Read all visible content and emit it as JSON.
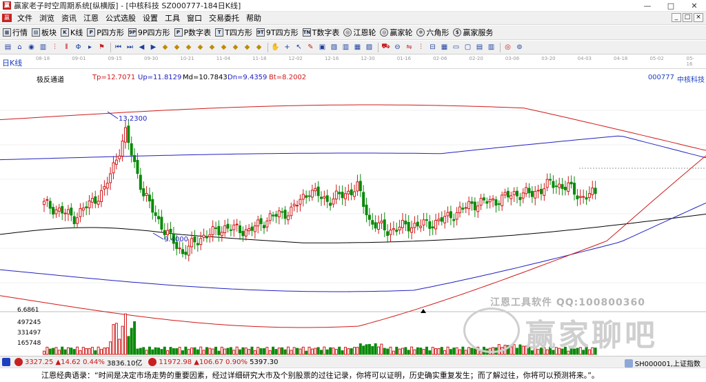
{
  "window": {
    "title": "赢家老子时空周期系统[纵横版] - [中核科技  SZ000777-184日K线]",
    "minimize": "—",
    "maximize": "□",
    "close": "✕"
  },
  "menu": {
    "items": [
      "文件",
      "浏览",
      "资讯",
      "江恩",
      "公式选股",
      "设置",
      "工具",
      "窗口",
      "交易委托",
      "帮助"
    ],
    "mdi_buttons": [
      "_",
      "□",
      "×"
    ]
  },
  "toolbar1": {
    "items": [
      {
        "label": "行情",
        "icon": "grid-icon",
        "glyph": "▦"
      },
      {
        "label": "板块",
        "icon": "blocks-icon",
        "glyph": "▤"
      },
      {
        "label": "K线",
        "icon": "kline-icon",
        "glyph": "K"
      },
      {
        "label": "P四方形",
        "icon": "p-square-icon",
        "glyph": "P"
      },
      {
        "label": "9P四方形",
        "icon": "9p-square-icon",
        "glyph": "9P"
      },
      {
        "label": "P数字表",
        "icon": "p-number-icon",
        "glyph": "P"
      },
      {
        "label": "T四方形",
        "icon": "t-square-icon",
        "glyph": "T"
      },
      {
        "label": "9T四方形",
        "icon": "9t-square-icon",
        "glyph": "9T"
      },
      {
        "label": "T数字表",
        "icon": "t-number-icon",
        "glyph": "TN"
      },
      {
        "label": "江恩轮",
        "icon": "gann-wheel-icon",
        "glyph": "◎",
        "round": true
      },
      {
        "label": "赢家轮",
        "icon": "winner-wheel-icon",
        "glyph": "◎",
        "round": true
      },
      {
        "label": "六角形",
        "icon": "hexagon-icon",
        "glyph": "✲",
        "round": true
      },
      {
        "label": "赢家服务",
        "icon": "service-icon",
        "glyph": "$",
        "round": true
      }
    ]
  },
  "toolbar2": {
    "tools": [
      {
        "name": "layout-icon",
        "glyph": "▤",
        "tone": "b"
      },
      {
        "name": "bell-icon",
        "glyph": "⌂",
        "tone": "b"
      },
      {
        "name": "cycle-icon",
        "glyph": "◉",
        "tone": "b"
      },
      {
        "name": "list-icon",
        "glyph": "▥",
        "tone": "b"
      },
      {
        "name": "candle-icon",
        "glyph": "⫶",
        "tone": "r"
      },
      {
        "name": "bars-icon",
        "glyph": "⫴",
        "tone": "r"
      },
      {
        "name": "line-type-icon",
        "glyph": "Φ",
        "tone": "b"
      },
      {
        "name": "arrow-icon",
        "glyph": "▸",
        "tone": "b"
      },
      {
        "name": "flag-icon",
        "glyph": "⚑",
        "tone": "r"
      },
      {
        "name": "first-icon",
        "glyph": "⏮",
        "tone": "b"
      },
      {
        "name": "next-icon",
        "glyph": "⏭",
        "tone": "b"
      },
      {
        "name": "left-icon",
        "glyph": "◀",
        "tone": "b"
      },
      {
        "name": "right-icon",
        "glyph": "▶",
        "tone": "b"
      },
      {
        "name": "diamond1-icon",
        "glyph": "◆",
        "tone": "y"
      },
      {
        "name": "diamond2-icon",
        "glyph": "◆",
        "tone": "y"
      },
      {
        "name": "diamond3-icon",
        "glyph": "◆",
        "tone": "y"
      },
      {
        "name": "diamond4-icon",
        "glyph": "◆",
        "tone": "y"
      },
      {
        "name": "diamond5-icon",
        "glyph": "◆",
        "tone": "y"
      },
      {
        "name": "diamond6-icon",
        "glyph": "◆",
        "tone": "y"
      },
      {
        "name": "diamond7-icon",
        "glyph": "◆",
        "tone": "y"
      },
      {
        "name": "diamond8-icon",
        "glyph": "◆",
        "tone": "y"
      },
      {
        "name": "diamond9-icon",
        "glyph": "◆",
        "tone": "y"
      },
      {
        "name": "hand-icon",
        "glyph": "✋",
        "tone": "b"
      },
      {
        "name": "crosshair-icon",
        "glyph": "+",
        "tone": "b"
      },
      {
        "name": "cursor-icon",
        "glyph": "↖",
        "tone": "b"
      },
      {
        "name": "pen-icon",
        "glyph": "✎",
        "tone": "r"
      },
      {
        "name": "note-icon",
        "glyph": "▣",
        "tone": "b"
      },
      {
        "name": "image-icon",
        "glyph": "▧",
        "tone": "b"
      },
      {
        "name": "book-icon",
        "glyph": "▥",
        "tone": "b"
      },
      {
        "name": "table-icon",
        "glyph": "▦",
        "tone": "b"
      },
      {
        "name": "chart-icon",
        "glyph": "▨",
        "tone": "b"
      },
      {
        "name": "truck-icon",
        "glyph": "⛟",
        "tone": "r"
      },
      {
        "name": "zoom-out-icon",
        "glyph": "⊖",
        "tone": "b"
      },
      {
        "name": "compare-icon",
        "glyph": "⇋",
        "tone": "r"
      },
      {
        "name": "kline-small-icon",
        "glyph": "⫶",
        "tone": "r"
      },
      {
        "name": "measure-icon",
        "glyph": "⊟",
        "tone": "b"
      },
      {
        "name": "grid2-icon",
        "glyph": "▦",
        "tone": "b"
      },
      {
        "name": "monitor-icon",
        "glyph": "▭",
        "tone": "b"
      },
      {
        "name": "window-icon",
        "glyph": "▢",
        "tone": "b"
      },
      {
        "name": "tile-icon",
        "glyph": "▤",
        "tone": "b"
      },
      {
        "name": "column-icon",
        "glyph": "▥",
        "tone": "b"
      },
      {
        "name": "target-icon",
        "glyph": "◎",
        "tone": "r"
      },
      {
        "name": "globe-icon",
        "glyph": "⊚",
        "tone": "b"
      }
    ]
  },
  "chart_header": {
    "period": "日K线",
    "date_ticks": [
      "08-18",
      "09-01",
      "09-15",
      "09-30",
      "10-21",
      "11-04",
      "11-18",
      "12-02",
      "12-16",
      "12-30",
      "01-16",
      "02-06",
      "02-20",
      "03-06",
      "03-20",
      "04-03",
      "04-18",
      "05-02",
      "05-16"
    ]
  },
  "indicator": {
    "name": "极反通道",
    "tp": "Tp=12.7071",
    "up": "Up=11.8129",
    "md": "Md=10.7843",
    "dn": "Dn=9.4359",
    "bt": "Bt=8.2002",
    "code": "000777",
    "stock_name": "中核科技"
  },
  "annotations": {
    "high": "13.2300",
    "low": "9.4000"
  },
  "volume": {
    "labels": [
      "6.6861",
      "497245",
      "331497",
      "165748"
    ]
  },
  "watermark": {
    "brand": "江恩工具软件  QQ:100800360",
    "big": "赢家聊吧",
    "url": "liaoba.yuanbo"
  },
  "status": {
    "sh_index": "3327.25",
    "sh_change": "▲14.62",
    "sh_pct": "0.44%",
    "sh_amount": "3836.10亿",
    "sz_index": "11972.98",
    "sz_change": "▲106.67",
    "sz_pct": "0.90%",
    "sz_amount": "5397.30",
    "right_label": "SH000001,上证指数"
  },
  "quote": {
    "text": "江恩经典语录：“时间是决定市场走势的重要因素，经过详细研究大市及个别股票的过往记录，你将可以证明，历史确实重复发生；而了解过往，你将可以预测将来。”。"
  },
  "chart_data": {
    "type": "candlestick",
    "price_range": [
      7.8,
      14.6
    ],
    "colors": {
      "up": "#d01818",
      "down": "#0a8a0a",
      "tp_bt": "#d01818",
      "up_dn": "#2020c0",
      "md": "#000000"
    }
  }
}
